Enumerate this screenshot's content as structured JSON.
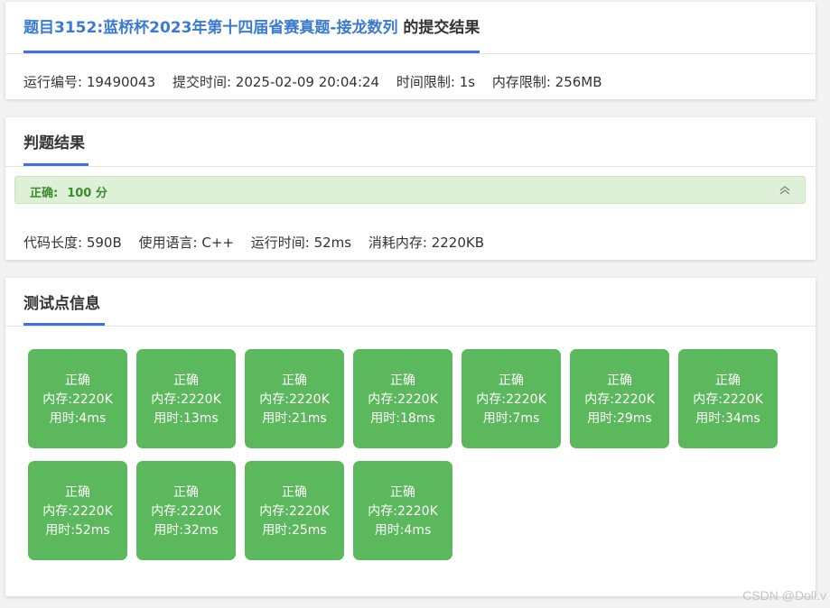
{
  "submission": {
    "problem_title": "题目3152:蓝桥杯2023年第十四届省赛真题-接龙数列",
    "title_suffix": " 的提交结果",
    "meta": [
      "运行编号: 19490043",
      "提交时间: 2025-02-09 20:04:24",
      "时间限制: 1s",
      "内存限制: 256MB"
    ]
  },
  "judge": {
    "title": "判题结果",
    "status": "正确:",
    "score": "100 分",
    "meta": [
      "代码长度: 590B",
      "使用语言: C++",
      "运行时间: 52ms",
      "消耗内存: 2220KB"
    ]
  },
  "testcases": {
    "title": "测试点信息",
    "items": [
      {
        "status": "正确",
        "memory": "内存:2220K",
        "time": "用时:4ms"
      },
      {
        "status": "正确",
        "memory": "内存:2220K",
        "time": "用时:13ms"
      },
      {
        "status": "正确",
        "memory": "内存:2220K",
        "time": "用时:21ms"
      },
      {
        "status": "正确",
        "memory": "内存:2220K",
        "time": "用时:18ms"
      },
      {
        "status": "正确",
        "memory": "内存:2220K",
        "time": "用时:7ms"
      },
      {
        "status": "正确",
        "memory": "内存:2220K",
        "time": "用时:29ms"
      },
      {
        "status": "正确",
        "memory": "内存:2220K",
        "time": "用时:34ms"
      },
      {
        "status": "正确",
        "memory": "内存:2220K",
        "time": "用时:52ms"
      },
      {
        "status": "正确",
        "memory": "内存:2220K",
        "time": "用时:32ms"
      },
      {
        "status": "正确",
        "memory": "内存:2220K",
        "time": "用时:25ms"
      },
      {
        "status": "正确",
        "memory": "内存:2220K",
        "time": "用时:4ms"
      }
    ]
  },
  "watermark": "CSDN @Doll.v",
  "colors": {
    "accent": "#3a73e8",
    "link": "#3a7ad2",
    "success_bg": "#dff0d8",
    "success_text": "#3c8a2e",
    "testcase_bg": "#5cb85c"
  },
  "icons": {
    "collapse": "double-chevron-up-icon"
  }
}
